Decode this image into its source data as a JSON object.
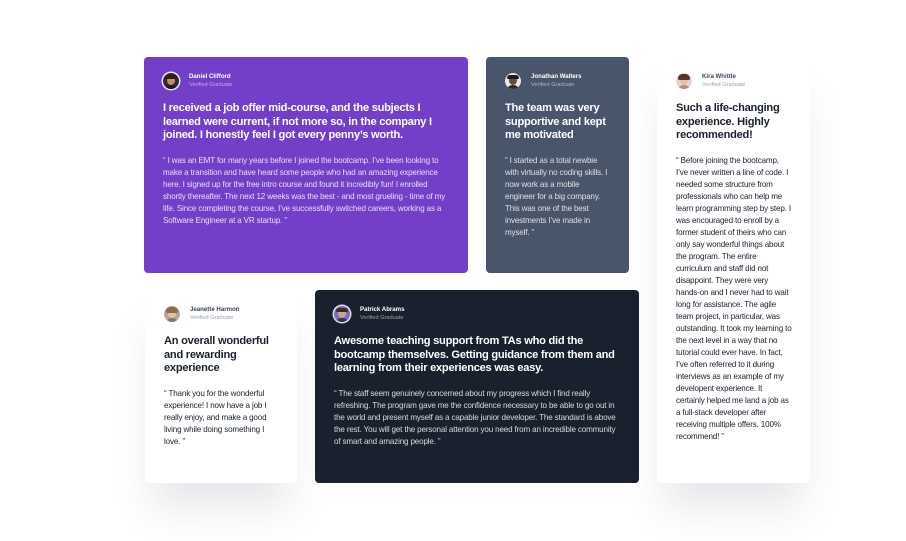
{
  "testimonials": [
    {
      "name": "Daniel Clifford",
      "role": "Verified Graduate",
      "headline": "I received a job offer mid-course, and the subjects I learned were current, if not more so, in the company I joined. I honestly feel I got every penny’s worth.",
      "quote": "“ I was an EMT for many years before I joined the bootcamp. I’ve been looking to make a transition and have heard some people who had an amazing experience here. I signed up for the free intro course and found it incredibly fun! I enrolled shortly thereafter. The next 12 weeks was the best - and most grueling - time of my life. Since completing the course, I’ve successfully switched careers, working as a Software Engineer at a VR startup. ”",
      "card_color": "#733fc8"
    },
    {
      "name": "Jonathan Walters",
      "role": "Verified Graduate",
      "headline": "The team was very supportive and kept me motivated",
      "quote": "“ I started as a total newbie with virtually no coding skills. I now work as a mobile engineer for a big company. This was one of the best investments I’ve made in myself. ”",
      "card_color": "#48556a"
    },
    {
      "name": "Jeanette Harmon",
      "role": "Verified Graduate",
      "headline": "An overall wonderful and rewarding experience",
      "quote": "“ Thank you for the wonderful experience! I now have a job I really enjoy, and make a good living while doing something I love. ”",
      "card_color": "#ffffff"
    },
    {
      "name": "Patrick Abrams",
      "role": "Verified Graduate",
      "headline": "Awesome teaching support from TAs who did the bootcamp themselves. Getting guidance from them and learning from their experiences was easy.",
      "quote": "“ The staff seem genuinely concerned about my progress which I find really refreshing. The program gave me the confidence necessary to be able to go out in the world and present myself as a capable junior developer. The standard is above the rest. You will get the personal attention you need from an incredible community of smart and amazing people. ”",
      "card_color": "#19212e"
    },
    {
      "name": "Kira Whittle",
      "role": "Verified Graduate",
      "headline": "Such a life-changing experience. Highly recommended!",
      "quote": "“ Before joining the bootcamp, I’ve never written a line of code. I needed some structure from professionals who can help me learn programming step by step. I was encouraged to enroll by a former student of theirs who can only say wonderful things about the program. The entire curriculum and staff did not disappoint. They were very hands-on and I never had to wait long for assistance. The agile team project, in particular, was outstanding. It took my learning to the next level in a way that no tutorial could ever have. In fact, I’ve often referred to it during interviews as an example of my developent experience. It certainly helped me land a job as a full-stack developer after receiving multiple offers. 100% recommend! ”",
      "card_color": "#ffffff"
    }
  ]
}
